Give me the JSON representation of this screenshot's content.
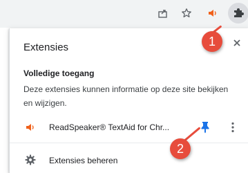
{
  "popup": {
    "title": "Extensies",
    "section_heading": "Volledige toegang",
    "section_description": "Deze extensies kunnen informatie op deze site bekijken en wijzigen.",
    "extension": {
      "name": "ReadSpeaker® TextAid for Chr...",
      "icon": "speaker-icon",
      "pinned": true
    },
    "manage_label": "Extensies beheren"
  },
  "toolbar": {
    "icons": [
      "share-icon",
      "bookmark-star-icon",
      "speaker-icon",
      "puzzle-icon"
    ]
  },
  "callouts": [
    "1",
    "2"
  ],
  "colors": {
    "accent_blue": "#1a73e8",
    "callout_red": "#e74c3c",
    "speaker_orange": "#f0611b"
  }
}
